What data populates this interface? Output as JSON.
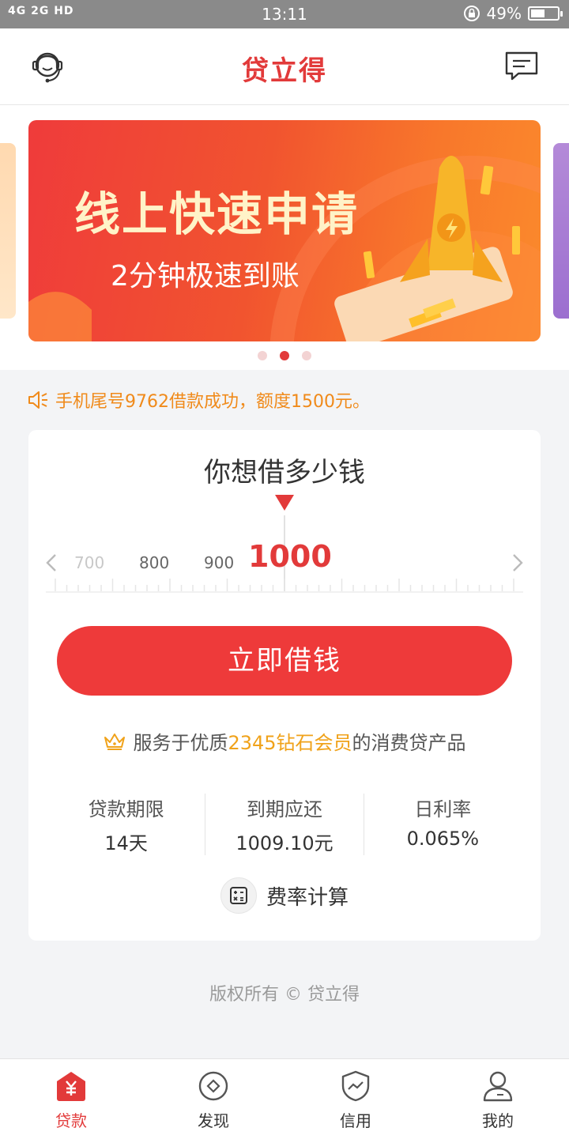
{
  "status_bar": {
    "network_left": "4G 2G HD",
    "time": "13:11",
    "battery": "49%",
    "battery_level": 0.49
  },
  "header": {
    "title": "贷立得",
    "left_icon": "customer-service-icon",
    "right_icon": "message-icon"
  },
  "banner": {
    "headline": "线上快速申请",
    "subline": "2分钟极速到账",
    "active_index": 1,
    "count": 3
  },
  "notice": {
    "icon": "speaker-icon",
    "text": "手机尾号9762借款成功，额度1500元。"
  },
  "loan_card": {
    "question": "你想借多少钱",
    "ruler_ticks": [
      "700",
      "800",
      "900"
    ],
    "selected_amount": "1000",
    "borrow_button": "立即借钱",
    "member_prefix": "服务于优质",
    "member_highlight": "2345钻石会员",
    "member_suffix": "的消费贷产品",
    "stats": [
      {
        "label": "贷款期限",
        "value": "14天"
      },
      {
        "label": "到期应还",
        "value": "1009.10元"
      },
      {
        "label": "日利率",
        "value": "0.065%"
      }
    ],
    "calculator_label": "费率计算"
  },
  "copyright": "版权所有 © 贷立得",
  "tabs": [
    {
      "label": "贷款",
      "icon": "loan-yen-icon",
      "active": true
    },
    {
      "label": "发现",
      "icon": "discover-icon",
      "active": false
    },
    {
      "label": "信用",
      "icon": "credit-shield-icon",
      "active": false
    },
    {
      "label": "我的",
      "icon": "profile-icon",
      "active": false
    }
  ],
  "colors": {
    "accent": "#e23a3a",
    "button": "#ee3a3a",
    "notice": "#f08a1a",
    "highlight": "#f0a21a"
  }
}
